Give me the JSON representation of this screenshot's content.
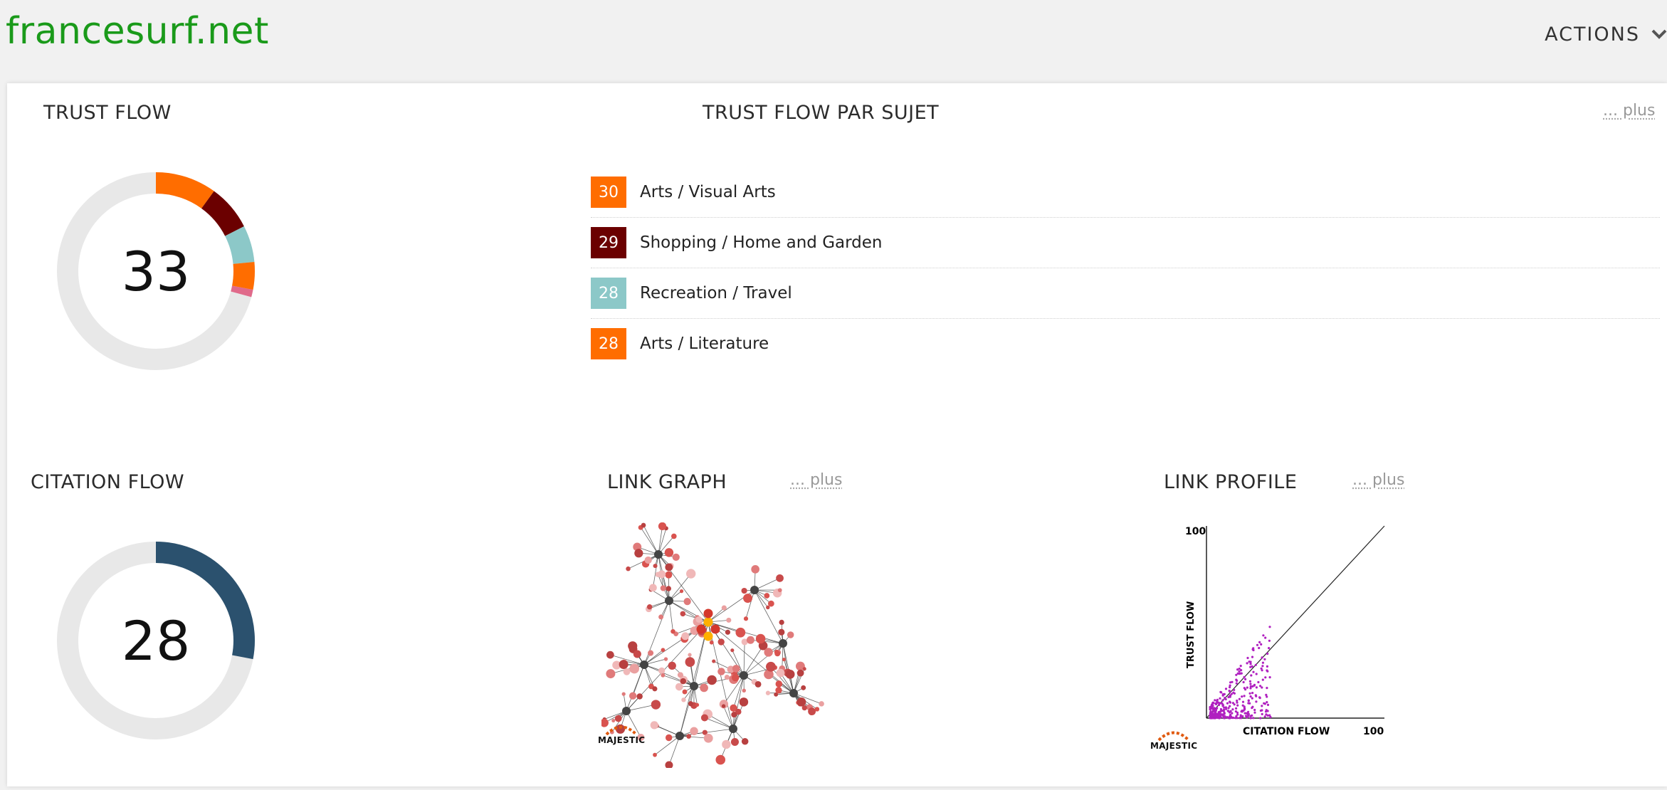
{
  "header": {
    "site": "francesurf.net",
    "actions_label": "ACTIONS"
  },
  "trust_flow": {
    "title": "TRUST FLOW",
    "value": "33",
    "segments": [
      {
        "color": "#ff6d00",
        "fraction": 0.1
      },
      {
        "color": "#6b0000",
        "fraction": 0.075
      },
      {
        "color": "#8cc8c8",
        "fraction": 0.06
      },
      {
        "color": "#ff6d00",
        "fraction": 0.045
      },
      {
        "color": "#e06a8a",
        "fraction": 0.012
      }
    ]
  },
  "topics": {
    "title": "TRUST FLOW PAR SUJET",
    "more": "... plus",
    "items": [
      {
        "score": "30",
        "label": "Arts / Visual Arts",
        "color": "#ff6d00"
      },
      {
        "score": "29",
        "label": "Shopping / Home and Garden",
        "color": "#6b0000"
      },
      {
        "score": "28",
        "label": "Recreation / Travel",
        "color": "#8cc8c8"
      },
      {
        "score": "28",
        "label": "Arts / Literature",
        "color": "#ff6d00"
      }
    ]
  },
  "citation_flow": {
    "title": "CITATION FLOW",
    "value": "28",
    "fraction": 0.28,
    "color": "#2b516e"
  },
  "link_graph": {
    "title": "LINK GRAPH",
    "more": "... plus",
    "logo_text": "MAJESTIC"
  },
  "link_profile": {
    "title": "LINK PROFILE",
    "more": "... plus",
    "logo_text": "MAJESTIC",
    "chart_data": {
      "type": "scatter",
      "xlabel": "CITATION FLOW",
      "ylabel": "TRUST FLOW",
      "xlim": [
        0,
        100
      ],
      "ylim": [
        0,
        100
      ],
      "x_max_label": "100",
      "y_max_label": "100",
      "point_color": "#b020c0"
    }
  },
  "colors": {
    "site_title": "#1a9a1a",
    "panel_bg": "#ffffff",
    "page_bg": "#f1f1f1"
  }
}
